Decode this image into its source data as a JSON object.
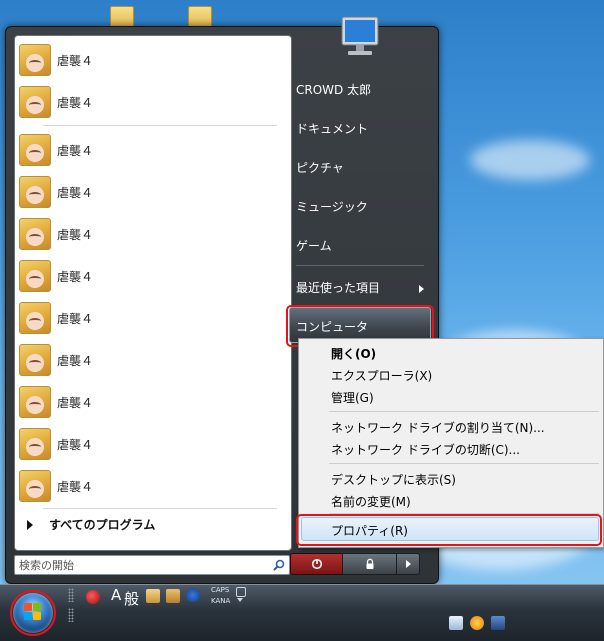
{
  "left_pane": {
    "programs": [
      {
        "label": "虐襲４"
      },
      {
        "label": "虐襲４"
      },
      {
        "label": "虐襲４"
      },
      {
        "label": "虐襲４"
      },
      {
        "label": "虐襲４"
      },
      {
        "label": "虐襲４"
      },
      {
        "label": "虐襲４"
      },
      {
        "label": "虐襲４"
      },
      {
        "label": "虐襲４"
      },
      {
        "label": "虐襲４"
      },
      {
        "label": "虐襲４"
      }
    ],
    "all_programs": "すべてのプログラム",
    "search_placeholder": "検索の開始"
  },
  "right_pane": {
    "items": [
      {
        "label": "CROWD 太郎"
      },
      {
        "label": "ドキュメント"
      },
      {
        "label": "ピクチャ"
      },
      {
        "label": "ミュージック"
      },
      {
        "label": "ゲーム"
      },
      {
        "label": "最近使った項目"
      },
      {
        "label": "コンピュータ"
      }
    ]
  },
  "context_menu": {
    "items": [
      {
        "label": "開く(O)"
      },
      {
        "label": "エクスプローラ(X)"
      },
      {
        "label": "管理(G)"
      },
      {
        "label": "ネットワーク ドライブの割り当て(N)..."
      },
      {
        "label": "ネットワーク ドライブの切断(C)..."
      },
      {
        "label": "デスクトップに表示(S)"
      },
      {
        "label": "名前の変更(M)"
      },
      {
        "label": "プロパティ(R)"
      }
    ]
  },
  "taskbar": {
    "ime_a": "A",
    "ime_mode": "般",
    "caps": "CAPS",
    "kana": "KANA"
  },
  "colors": {
    "highlight": "#e8121a",
    "menu_bg": "#2e3338"
  }
}
